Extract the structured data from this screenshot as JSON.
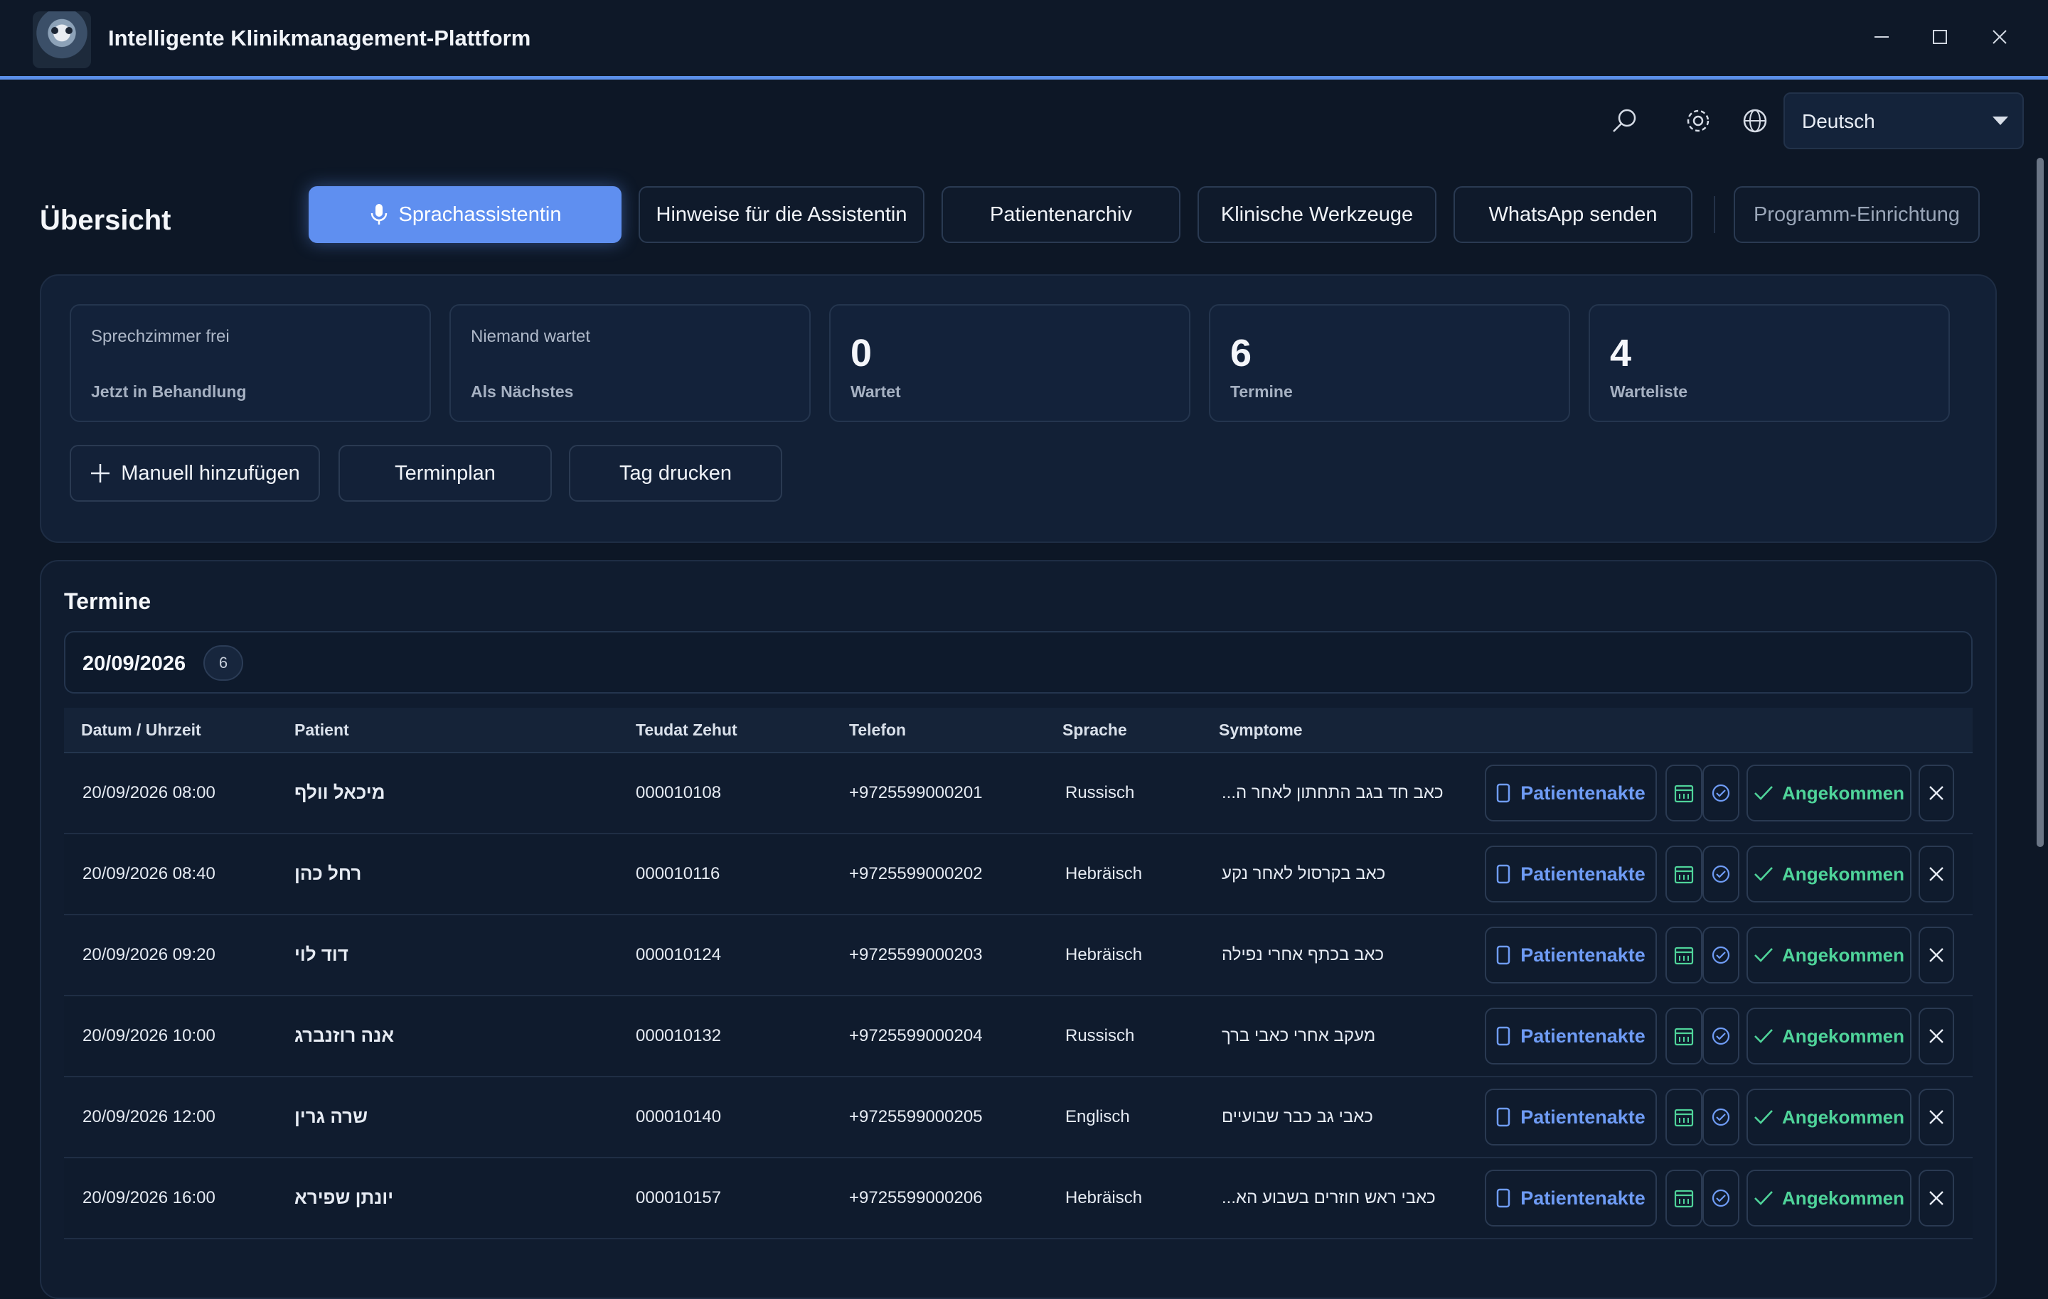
{
  "app": {
    "title": "Intelligente Klinikmanagement-Plattform"
  },
  "toolbar": {
    "language": "Deutsch"
  },
  "page": {
    "title": "Übersicht"
  },
  "nav": {
    "voice_assistant": "Sprachassistentin",
    "assistant_notes": "Hinweise für die Assistentin",
    "patient_archive": "Patientenarchiv",
    "clinical_tools": "Klinische Werkzeuge",
    "send_whatsapp": "WhatsApp senden",
    "program_setup": "Programm-Einrichtung"
  },
  "stats": {
    "room": {
      "label": "Sprechzimmer frei",
      "sub": "Jetzt in Behandlung"
    },
    "next": {
      "label": "Niemand wartet",
      "sub": "Als Nächstes"
    },
    "waiting": {
      "value": "0",
      "label": "Wartet"
    },
    "appointments": {
      "value": "6",
      "label": "Termine"
    },
    "waitlist": {
      "value": "4",
      "label": "Warteliste"
    }
  },
  "actions": {
    "add_manual": "Manuell hinzufügen",
    "schedule": "Terminplan",
    "print_day": "Tag drucken"
  },
  "appointments": {
    "title": "Termine",
    "date": "20/09/2026",
    "count": "6",
    "columns": {
      "datetime": "Datum / Uhrzeit",
      "patient": "Patient",
      "id": "Teudat Zehut",
      "phone": "Telefon",
      "language": "Sprache",
      "symptoms": "Symptome"
    },
    "record_label": "Patientenakte",
    "arrived_label": "Angekommen",
    "rows": [
      {
        "datetime": "20/09/2026 08:00",
        "patient": "מיכאל וולף",
        "id": "000010108",
        "phone": "+9725599000201",
        "language": "Russisch",
        "symptoms": "כאב חד בגב התחתון לאחר ה..."
      },
      {
        "datetime": "20/09/2026 08:40",
        "patient": "רחל כהן",
        "id": "000010116",
        "phone": "+9725599000202",
        "language": "Hebräisch",
        "symptoms": "כאב בקרסול לאחר נקע"
      },
      {
        "datetime": "20/09/2026 09:20",
        "patient": "דוד לוי",
        "id": "000010124",
        "phone": "+9725599000203",
        "language": "Hebräisch",
        "symptoms": "כאב בכתף אחרי נפילה"
      },
      {
        "datetime": "20/09/2026 10:00",
        "patient": "אנה רוזנברג",
        "id": "000010132",
        "phone": "+9725599000204",
        "language": "Russisch",
        "symptoms": "מעקב אחרי כאבי ברך"
      },
      {
        "datetime": "20/09/2026 12:00",
        "patient": "שרה גרין",
        "id": "000010140",
        "phone": "+9725599000205",
        "language": "Englisch",
        "symptoms": "כאבי גב כבר שבועיים"
      },
      {
        "datetime": "20/09/2026 16:00",
        "patient": "יונתן שפירא",
        "id": "000010157",
        "phone": "+9725599000206",
        "language": "Hebräisch",
        "symptoms": "כאבי ראש חוזרים בשבוע הא..."
      }
    ]
  },
  "colors": {
    "accent": "#5f8ff0",
    "success": "#4fd49a",
    "background": "#0d1726"
  }
}
